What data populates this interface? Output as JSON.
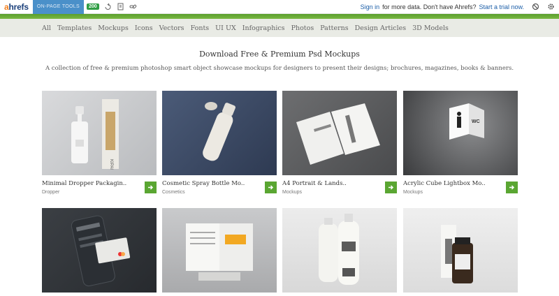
{
  "ahrefs_bar": {
    "logo_a": "a",
    "logo_rest": "hrefs",
    "onpage_label": "ON-PAGE TOOLS",
    "status_code": "200",
    "signin_link": "Sign in",
    "signin_rest": "for more data. Don't have Ahrefs?",
    "trial_link": "Start a trial now."
  },
  "nav": {
    "items": [
      "All",
      "Templates",
      "Mockups",
      "Icons",
      "Vectors",
      "Fonts",
      "UI UX",
      "Infographics",
      "Photos",
      "Patterns",
      "Design Articles",
      "3D Models"
    ]
  },
  "page": {
    "title": "Download Free & Premium Psd Mockups",
    "subtitle": "A collection of free & premium photoshop smart object showcase mockups for designers to present their designs; brochures, magazines, books & banners."
  },
  "cards": [
    {
      "title": "Minimal Dropper Packagin..",
      "category": "Dropper"
    },
    {
      "title": "Cosmetic Spray Bottle Mo..",
      "category": "Cosmetics"
    },
    {
      "title": "A4 Portrait & Lands..",
      "category": "Mockups"
    },
    {
      "title": "Acrylic Cube Lightbox Mo..",
      "category": "Mockups"
    },
    {
      "title": "",
      "category": ""
    },
    {
      "title": "",
      "category": ""
    },
    {
      "title": "",
      "category": ""
    },
    {
      "title": "",
      "category": ""
    }
  ],
  "thumb_text": {
    "wc": "WC",
    "kipai": "KIPAI"
  },
  "colors": {
    "accent_green": "#5aa632",
    "nav_bg": "#e9ebe5",
    "link_blue": "#1b5ea8"
  }
}
